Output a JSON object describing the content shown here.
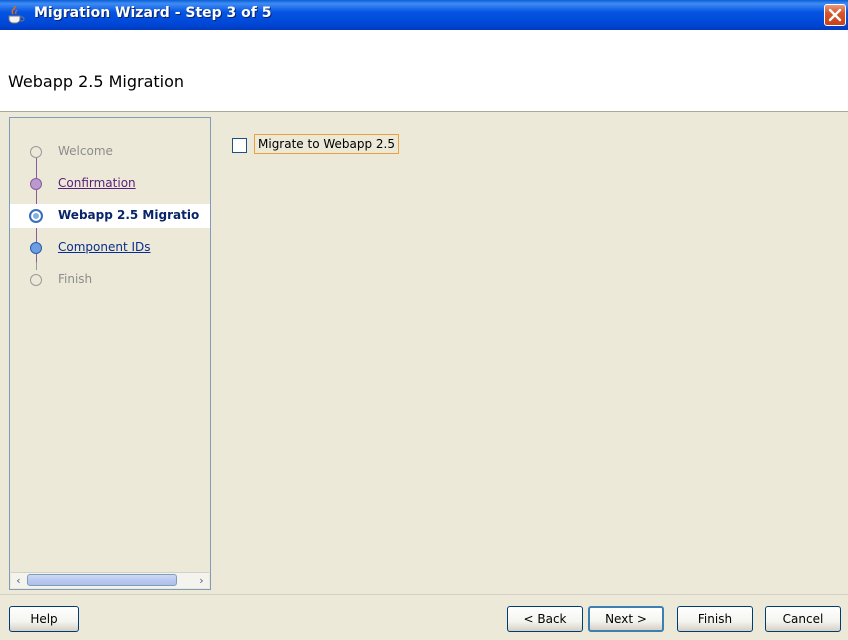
{
  "window": {
    "title": "Migration Wizard - Step 3 of 5",
    "close_icon": "close-icon",
    "app_icon": "java-cup-icon"
  },
  "header": {
    "title": "Webapp 2.5 Migration"
  },
  "steps": [
    {
      "label": "Welcome",
      "state": "visited-muted"
    },
    {
      "label": "Confirmation",
      "state": "visited-link"
    },
    {
      "label": "Webapp 2.5 Migratio",
      "state": "current"
    },
    {
      "label": "Component IDs",
      "state": "link"
    },
    {
      "label": "Finish",
      "state": "muted"
    }
  ],
  "content": {
    "checkbox_label": "Migrate to Webapp 2.5",
    "checkbox_checked": false
  },
  "buttons": {
    "help": "Help",
    "back": "< Back",
    "next": "Next >",
    "finish": "Finish",
    "cancel": "Cancel"
  },
  "colors": {
    "titlebar": "#0047d6",
    "close": "#d8552a",
    "focus_border": "#e8a33c"
  }
}
